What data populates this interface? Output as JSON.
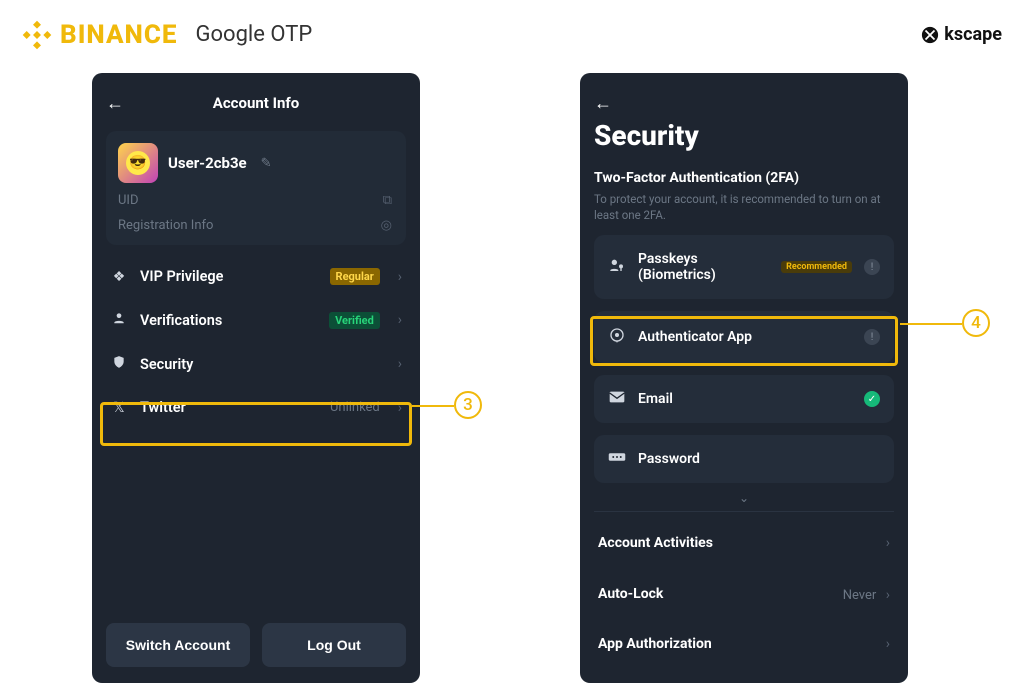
{
  "header": {
    "brand": "BINANCE",
    "subtitle": "Google OTP",
    "watermark": "kscape"
  },
  "left_phone": {
    "title": "Account Info",
    "user": {
      "name": "User-2cb3e"
    },
    "uid_label": "UID",
    "reg_label": "Registration Info",
    "rows": {
      "vip": {
        "label": "VIP Privilege",
        "tag": "Regular"
      },
      "verif": {
        "label": "Verifications",
        "tag": "Verified"
      },
      "security": {
        "label": "Security"
      },
      "twitter": {
        "label": "Twitter",
        "status": "Unlinked"
      }
    },
    "buttons": {
      "switch": "Switch Account",
      "logout": "Log Out"
    },
    "callout": "3"
  },
  "right_phone": {
    "title": "Security",
    "section_title": "Two-Factor Authentication (2FA)",
    "section_desc": "To protect your account, it is recommended to turn on at least one 2FA.",
    "cards": {
      "passkeys": {
        "label": "Passkeys (Biometrics)",
        "badge": "Recommended"
      },
      "auth": {
        "label": "Authenticator App"
      },
      "email": {
        "label": "Email"
      },
      "password": {
        "label": "Password"
      }
    },
    "rows": {
      "activities": {
        "label": "Account Activities"
      },
      "autolock": {
        "label": "Auto-Lock",
        "value": "Never"
      },
      "appauth": {
        "label": "App Authorization"
      }
    },
    "callout": "4"
  }
}
